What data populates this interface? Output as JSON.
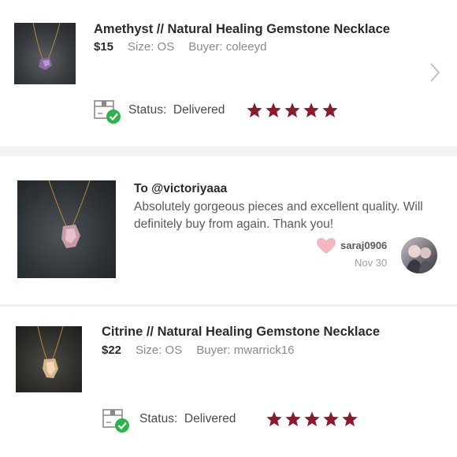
{
  "listings": [
    {
      "title": "Amethyst // Natural Healing Gemstone Necklace",
      "price": "$15",
      "size": "Size: OS",
      "buyer": "Buyer: coleeyd",
      "status_label": "Status:",
      "status_value": "Delivered",
      "rating": 5
    },
    {
      "title": "Citrine // Natural Healing Gemstone Necklace",
      "price": "$22",
      "size": "Size: OS",
      "buyer": "Buyer: mwarrick16",
      "status_label": "Status:",
      "status_value": "Delivered",
      "rating": 5
    }
  ],
  "comment": {
    "to": "To @victoriyaaa",
    "body": "Absolutely gorgeous pieces and excellent quality. Will definitely buy from again. Thank you!",
    "username": "saraj0906",
    "date": "Nov 30"
  },
  "colors": {
    "star": "#8b1a2e",
    "status_check": "#2eb34a",
    "heart": "#f4b6c2",
    "divider": "#e4e4e4"
  },
  "icons": {
    "chevron": "chevron-right-icon",
    "status": "delivered-box-icon",
    "star": "star-icon",
    "heart": "heart-icon"
  }
}
